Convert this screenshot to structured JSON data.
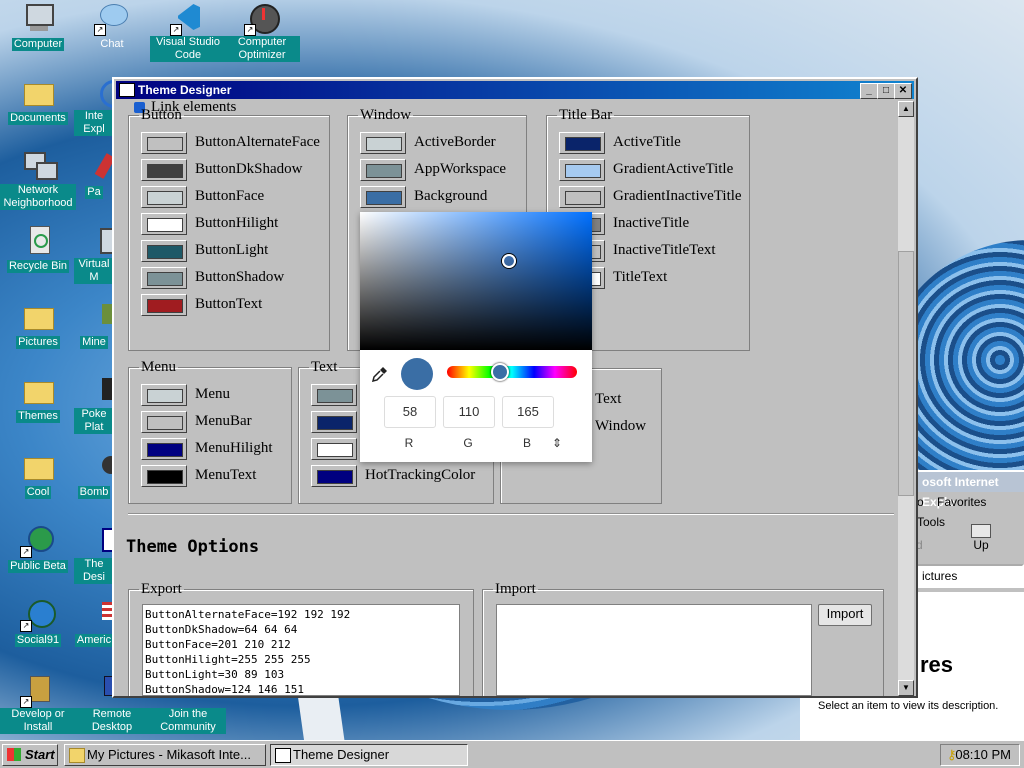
{
  "desktop": {
    "icons": [
      {
        "label": "Computer"
      },
      {
        "label": "Chat"
      },
      {
        "label": "Visual Studio Code"
      },
      {
        "label": "Computer Optimizer"
      },
      {
        "label": "Documents"
      },
      {
        "label": "Inte Expl"
      },
      {
        "label": "Network Neighborhood"
      },
      {
        "label": "Pa"
      },
      {
        "label": "Recycle Bin"
      },
      {
        "label": "Virtual M"
      },
      {
        "label": "Pictures"
      },
      {
        "label": "Mine"
      },
      {
        "label": "Themes"
      },
      {
        "label": "Poke Plat"
      },
      {
        "label": "Cool"
      },
      {
        "label": "Bomb"
      },
      {
        "label": "Public Beta"
      },
      {
        "label": "The Desi"
      },
      {
        "label": "Social91"
      },
      {
        "label": "Americ"
      },
      {
        "label": "Develop or Install"
      },
      {
        "label": "Remote Desktop"
      },
      {
        "label": "Join the Community"
      }
    ]
  },
  "ie_window": {
    "title": "osoft Internet Explo",
    "menu": [
      "o",
      "Favorites",
      "Tools"
    ],
    "toolbar_back": "rd",
    "toolbar_up": "Up",
    "address": "ictures",
    "heading": "res",
    "description": "Select an item to view its description."
  },
  "window": {
    "title": "Theme Designer",
    "minimize": "_",
    "maximize": "□",
    "close": "✕",
    "link_elements_label": "Link elements",
    "groups": {
      "button": {
        "legend": "Button",
        "items": [
          {
            "label": "ButtonAlternateFace",
            "color": "#c0c0c0"
          },
          {
            "label": "ButtonDkShadow",
            "color": "#404040"
          },
          {
            "label": "ButtonFace",
            "color": "#c9d2d4"
          },
          {
            "label": "ButtonHilight",
            "color": "#ffffff"
          },
          {
            "label": "ButtonLight",
            "color": "#1e5967"
          },
          {
            "label": "ButtonShadow",
            "color": "#7c9297"
          },
          {
            "label": "ButtonText",
            "color": "#a01c20"
          }
        ]
      },
      "window": {
        "legend": "Window",
        "items": [
          {
            "label": "ActiveBorder",
            "color": "#c9d2d4"
          },
          {
            "label": "AppWorkspace",
            "color": "#7c9297"
          },
          {
            "label": "Background",
            "color": "#3a6ea5"
          }
        ]
      },
      "titlebar": {
        "legend": "Title Bar",
        "items": [
          {
            "label": "ActiveTitle",
            "color": "#0a246a"
          },
          {
            "label": "GradientActiveTitle",
            "color": "#a6caf0"
          },
          {
            "label": "GradientInactiveTitle",
            "color": "#c0c0c0"
          },
          {
            "label": "InactiveTitle",
            "color": "#808080"
          },
          {
            "label": "InactiveTitleText",
            "color": "#c0c0c0"
          },
          {
            "label": "TitleText",
            "color": "#ffffff"
          }
        ]
      },
      "menu": {
        "legend": "Menu",
        "items": [
          {
            "label": "Menu",
            "color": "#c9d2d4"
          },
          {
            "label": "MenuBar",
            "color": "#c0c0c0"
          },
          {
            "label": "MenuHilight",
            "color": "#000080"
          },
          {
            "label": "MenuText",
            "color": "#000000"
          }
        ]
      },
      "text": {
        "legend": "Text",
        "items": [
          {
            "label": "",
            "color": "#7c9297"
          },
          {
            "label": "",
            "color": "#0a246a"
          },
          {
            "label": "",
            "color": "#ffffff"
          },
          {
            "label": "HotTrackingColor",
            "color": "#000080"
          }
        ]
      },
      "other": {
        "items": [
          {
            "label": "Text"
          },
          {
            "label": "Window"
          }
        ]
      }
    },
    "theme_options_title": "Theme Options",
    "export": {
      "legend": "Export",
      "lines": "ButtonAlternateFace=192 192 192\nButtonDkShadow=64 64 64\nButtonFace=201 210 212\nButtonHilight=255 255 255\nButtonLight=30 89 103\nButtonShadow=124 146 151"
    },
    "import": {
      "legend": "Import",
      "button_label": "Import"
    }
  },
  "picker": {
    "current_color": "#3a6ea5",
    "r": "58",
    "g": "110",
    "b": "165",
    "r_label": "R",
    "g_label": "G",
    "b_label": "B",
    "mode_toggle": "⇕"
  },
  "taskbar": {
    "start_label": "Start",
    "items": [
      {
        "label": "My Pictures - Mikasoft Inte..."
      },
      {
        "label": "Theme Designer"
      }
    ],
    "clock": "08:10 PM"
  }
}
